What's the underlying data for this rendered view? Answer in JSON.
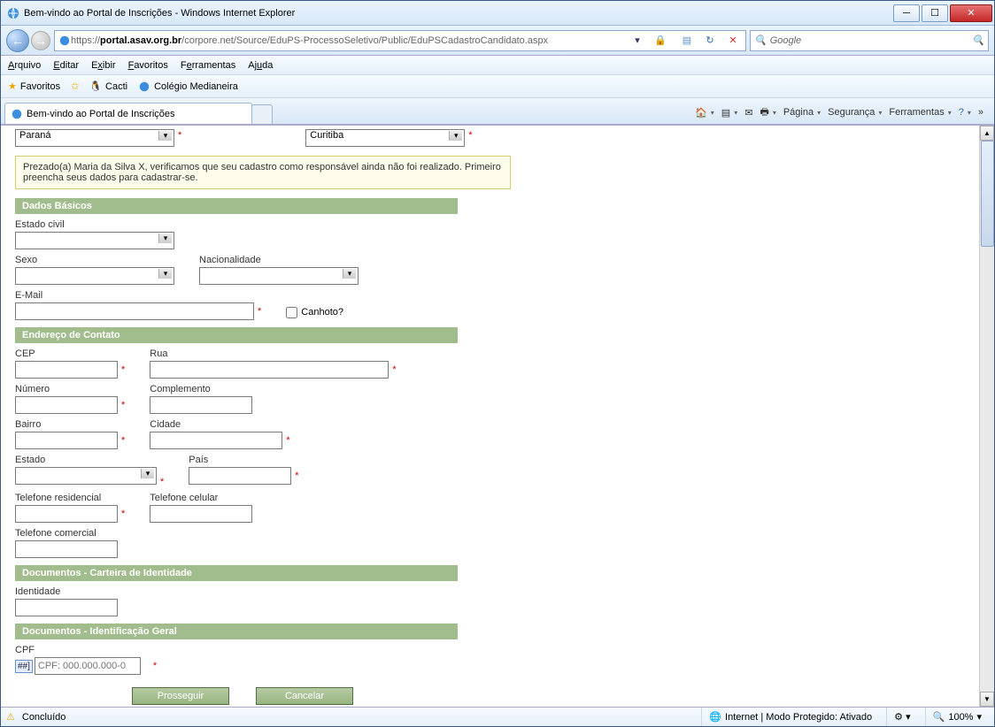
{
  "window": {
    "title": "Bem-vindo ao Portal de Inscrições - Windows Internet Explorer"
  },
  "nav": {
    "url_host": "portal.asav.org.br",
    "url_prefix": "https://",
    "url_path": "/corpore.net/Source/EduPS-ProcessoSeletivo/Public/EduPSCadastroCandidato.aspx",
    "search_placeholder": "Google"
  },
  "menu": [
    "Arquivo",
    "Editar",
    "Exibir",
    "Favoritos",
    "Ferramentas",
    "Ajuda"
  ],
  "favorites": {
    "label": "Favoritos",
    "items": [
      "Cacti",
      "Colégio Medianeira"
    ]
  },
  "tab": {
    "title": "Bem-vindo ao Portal de Inscrições"
  },
  "cmdbar": {
    "page": "Página",
    "security": "Segurança",
    "tools": "Ferramentas"
  },
  "top_selects": {
    "left": "Paraná",
    "right": "Curitiba"
  },
  "notice": "Prezado(a) Maria da Silva X, verificamos que seu cadastro como responsável ainda não foi realizado. Primeiro preencha seus dados para cadastrar-se.",
  "sections": {
    "basico": "Dados Básicos",
    "endereco": "Endereço de Contato",
    "docid": "Documentos - Carteira de Identidade",
    "docgeral": "Documentos - Identificação Geral"
  },
  "labels": {
    "estado_civil": "Estado civil",
    "sexo": "Sexo",
    "nacionalidade": "Nacionalidade",
    "email": "E-Mail",
    "canhoto": "Canhoto?",
    "cep": "CEP",
    "rua": "Rua",
    "numero": "Número",
    "complemento": "Complemento",
    "bairro": "Bairro",
    "cidade": "Cidade",
    "estado": "Estado",
    "pais": "País",
    "tel_res": "Telefone residencial",
    "tel_cel": "Telefone celular",
    "tel_com": "Telefone comercial",
    "identidade": "Identidade",
    "cpf": "CPF",
    "cpf_badge": "##]",
    "cpf_placeholder": "CPF: 000.000.000-0"
  },
  "buttons": {
    "prosseguir": "Prosseguir",
    "cancelar": "Cancelar"
  },
  "status": {
    "left": "Concluído",
    "zone": "Internet | Modo Protegido: Ativado",
    "zoom": "100%"
  }
}
